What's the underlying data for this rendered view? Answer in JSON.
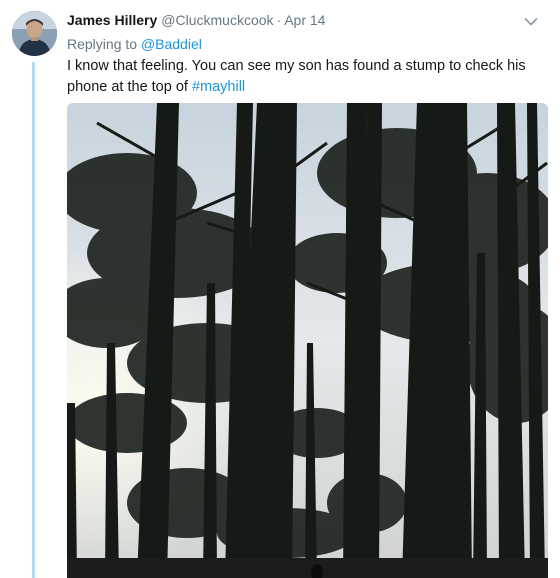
{
  "tweet": {
    "display_name": "James Hillery",
    "handle": "@Cluckmuckcook",
    "separator": "·",
    "timestamp": "Apr 14",
    "replying_prefix": "Replying to ",
    "replying_to": "@Baddiel",
    "text_main": "I know that feeling. You can see my son has found a stump to check his phone at the top of ",
    "hashtag": "#mayhill",
    "caret_icon": "chevron-down-icon",
    "colors": {
      "link": "#1b95e0",
      "muted": "#657786",
      "thread_line": "#b3dbf2",
      "text": "#14171a"
    }
  }
}
